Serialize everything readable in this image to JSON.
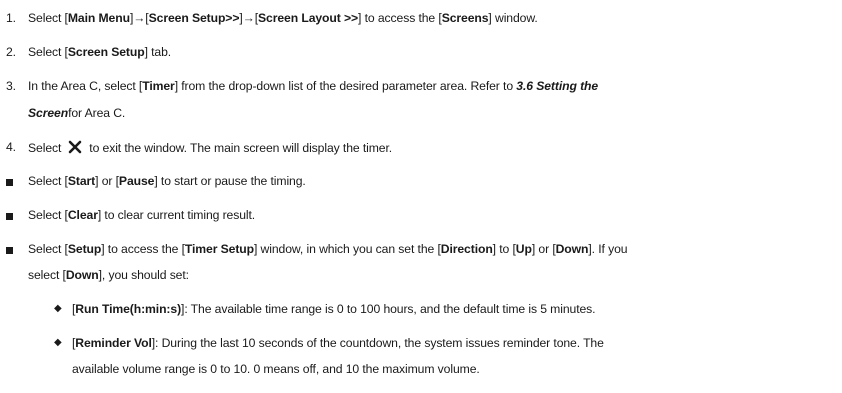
{
  "steps": [
    {
      "num": "1.",
      "parts": [
        "Select [",
        "Main Menu",
        "]→[",
        "Screen Setup>>",
        "]→[",
        "Screen Layout >>",
        "] to access the [",
        "Screens",
        "] window."
      ]
    },
    {
      "num": "2.",
      "parts": [
        "Select [",
        "Screen Setup",
        "] tab."
      ]
    },
    {
      "num": "3.",
      "line1": [
        "In the Area C, select [",
        "Timer",
        "] from the drop-down list of the desired parameter area. Refer to "
      ],
      "italic1": "3.6 Setting the",
      "italic2": "Screen",
      "tail2": "for Area C."
    },
    {
      "num": "4.",
      "pre": "Select",
      "icon": "close-icon",
      "post": "to exit the window. The main screen will display the timer."
    }
  ],
  "bullets": [
    {
      "parts": [
        "Select [",
        "Start",
        "] or [",
        "Pause",
        "] to start or pause the timing."
      ]
    },
    {
      "parts": [
        "Select [",
        "Clear",
        "] to clear current timing result."
      ]
    },
    {
      "line1": [
        "Select [",
        "Setup",
        "] to access the [",
        "Timer Setup",
        "] window, in which you can set the [",
        "Direction",
        "] to [",
        "Up",
        "] or [",
        "Down",
        "]. If you"
      ],
      "line2": [
        "select [",
        "Down",
        "], you should set:"
      ]
    }
  ],
  "subbullets": [
    {
      "parts": [
        "[",
        "Run Time(h:min:s)",
        "]: The available time range is 0 to 100 hours, and the default time is 5 minutes."
      ]
    },
    {
      "line1": [
        "[",
        "Reminder Vol",
        "]: During the last 10 seconds of the countdown, the system issues reminder tone. The"
      ],
      "line2": "available volume range is 0 to 10. 0 means off, and 10 the maximum volume."
    }
  ]
}
